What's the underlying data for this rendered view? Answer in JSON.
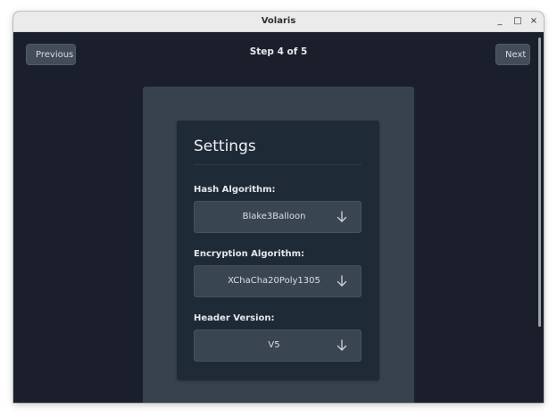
{
  "window": {
    "title": "Volaris",
    "controls": {
      "minimize": "_",
      "maximize": "□",
      "close": "×"
    }
  },
  "nav": {
    "previous_label": "Previous",
    "next_label": "Next",
    "step_text": "Step 4 of 5"
  },
  "settings": {
    "title": "Settings",
    "fields": [
      {
        "label": "Hash Algorithm:",
        "value": "Blake3Balloon",
        "icon": "arrow-down-icon"
      },
      {
        "label": "Encryption Algorithm:",
        "value": "XChaCha20Poly1305",
        "icon": "arrow-down-icon"
      },
      {
        "label": "Header Version:",
        "value": "V5",
        "icon": "arrow-down-icon"
      }
    ]
  },
  "colors": {
    "background": "#1a1f2b",
    "panel": "#37424e",
    "card": "#1f2a37",
    "select": "#3a4552",
    "button": "#434c58"
  }
}
